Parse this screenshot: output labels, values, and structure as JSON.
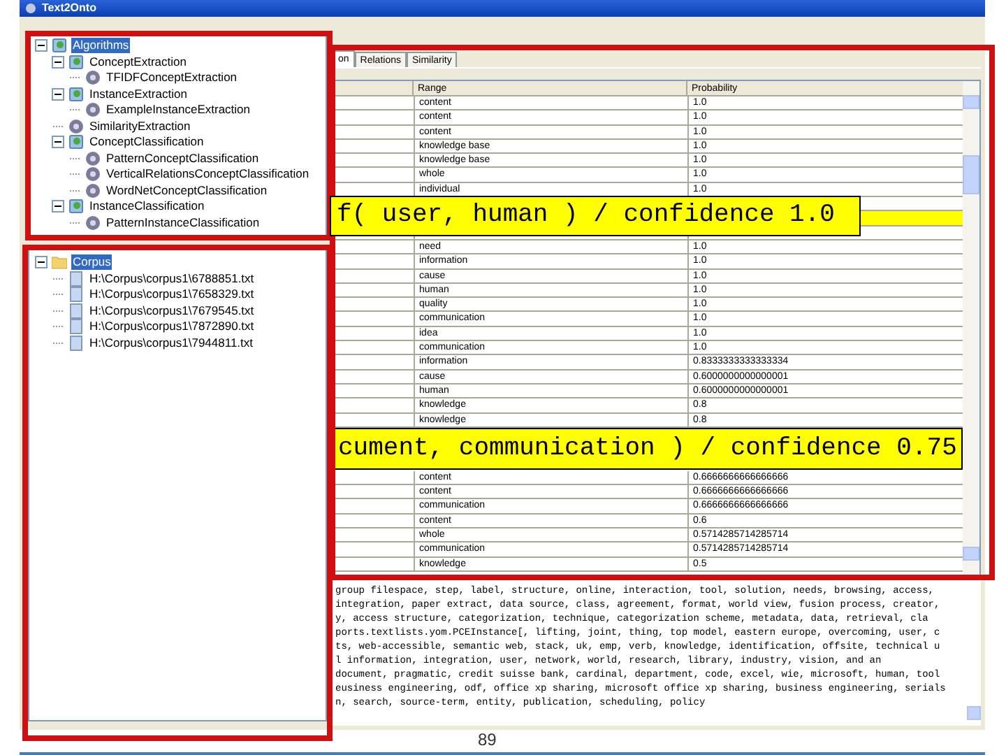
{
  "window": {
    "title": "Text2Onto"
  },
  "algorithm_tree": [
    {
      "label": "Algorithms",
      "kind": "algorithm",
      "selected": true,
      "expanded": true,
      "children": [
        {
          "label": "ConceptExtraction",
          "kind": "algorithm",
          "selected": false,
          "expanded": true,
          "children": [
            {
              "label": "TFIDFConceptExtraction",
              "kind": "method",
              "selected": false
            }
          ]
        },
        {
          "label": "InstanceExtraction",
          "kind": "algorithm",
          "selected": false,
          "expanded": true,
          "children": [
            {
              "label": "ExampleInstanceExtraction",
              "kind": "method",
              "selected": false
            }
          ]
        },
        {
          "label": "SimilarityExtraction",
          "kind": "method",
          "selected": false
        },
        {
          "label": "ConceptClassification",
          "kind": "algorithm",
          "selected": false,
          "expanded": true,
          "children": [
            {
              "label": "PatternConceptClassification",
              "kind": "method",
              "selected": false
            },
            {
              "label": "VerticalRelationsConceptClassification",
              "kind": "method",
              "selected": false
            },
            {
              "label": "WordNetConceptClassification",
              "kind": "method",
              "selected": false
            }
          ]
        },
        {
          "label": "InstanceClassification",
          "kind": "algorithm",
          "selected": false,
          "expanded": true,
          "children": [
            {
              "label": "PatternInstanceClassification",
              "kind": "method",
              "selected": false
            }
          ]
        }
      ]
    }
  ],
  "corpus_tree": [
    {
      "label": "Corpus",
      "kind": "folder",
      "selected": true,
      "expanded": true,
      "children": [
        {
          "label": "H:\\Corpus\\corpus1\\6788851.txt",
          "kind": "file",
          "selected": false
        },
        {
          "label": "H:\\Corpus\\corpus1\\7658329.txt",
          "kind": "file",
          "selected": false
        },
        {
          "label": "H:\\Corpus\\corpus1\\7679545.txt",
          "kind": "file",
          "selected": false
        },
        {
          "label": "H:\\Corpus\\corpus1\\7872890.txt",
          "kind": "file",
          "selected": false
        },
        {
          "label": "H:\\Corpus\\corpus1\\7944811.txt",
          "kind": "file",
          "selected": false
        }
      ]
    }
  ],
  "tabs": [
    {
      "label": "on",
      "selected": true
    },
    {
      "label": "Relations",
      "selected": false
    },
    {
      "label": "Similarity",
      "selected": false
    }
  ],
  "table": {
    "columns": [
      "Range",
      "Probability"
    ],
    "rows": [
      {
        "kind": "row",
        "range": "content",
        "probability": "1.0",
        "selected": false
      },
      {
        "kind": "row",
        "range": "content",
        "probability": "1.0",
        "selected": false
      },
      {
        "kind": "row",
        "range": "content",
        "probability": "1.0",
        "selected": false
      },
      {
        "kind": "row",
        "range": "knowledge base",
        "probability": "1.0",
        "selected": false
      },
      {
        "kind": "row",
        "range": "knowledge base",
        "probability": "1.0",
        "selected": false
      },
      {
        "kind": "row",
        "range": "whole",
        "probability": "1.0",
        "selected": false
      },
      {
        "kind": "row",
        "range": "individual",
        "probability": "1.0",
        "selected": false
      },
      {
        "kind": "row",
        "selected": false
      },
      {
        "kind": "row",
        "selected": true
      },
      {
        "kind": "row",
        "selected": false
      },
      {
        "kind": "row",
        "range": "need",
        "probability": "1.0",
        "selected": false
      },
      {
        "kind": "row",
        "range": "information",
        "probability": "1.0",
        "selected": false
      },
      {
        "kind": "row",
        "range": "cause",
        "probability": "1.0",
        "selected": false
      },
      {
        "kind": "row",
        "range": "human",
        "probability": "1.0",
        "selected": false
      },
      {
        "kind": "row",
        "range": "quality",
        "probability": "1.0",
        "selected": false
      },
      {
        "kind": "row",
        "range": "communication",
        "probability": "1.0",
        "selected": false
      },
      {
        "kind": "row",
        "range": "idea",
        "probability": "1.0",
        "selected": false
      },
      {
        "kind": "row",
        "range": "communication",
        "probability": "1.0",
        "selected": false
      },
      {
        "kind": "row",
        "range": "information",
        "probability": "0.8333333333333334",
        "selected": false
      },
      {
        "kind": "row",
        "range": "cause",
        "probability": "0.6000000000000001",
        "selected": false
      },
      {
        "kind": "row",
        "range": "human",
        "probability": "0.6000000000000001",
        "selected": false
      },
      {
        "kind": "row",
        "range": "knowledge",
        "probability": "0.8",
        "selected": false
      },
      {
        "kind": "row",
        "range": "knowledge",
        "probability": "0.8",
        "selected": false
      },
      {
        "kind": "callout",
        "text": "cument, communication ) / confidence 0.75"
      },
      {
        "kind": "row",
        "range": "content",
        "probability": "0.6666666666666666",
        "selected": false
      },
      {
        "kind": "row",
        "range": "content",
        "probability": "0.6666666666666666",
        "selected": false
      },
      {
        "kind": "row",
        "range": "communication",
        "probability": "0.6666666666666666",
        "selected": false
      },
      {
        "kind": "row",
        "range": "content",
        "probability": "0.6",
        "selected": false
      },
      {
        "kind": "row",
        "range": "whole",
        "probability": "0.5714285714285714",
        "selected": false
      },
      {
        "kind": "row",
        "range": "communication",
        "probability": "0.5714285714285714",
        "selected": false
      },
      {
        "kind": "row",
        "range": "knowledge",
        "probability": "0.5",
        "selected": false
      }
    ]
  },
  "text_area": [
    "group filespace, step, label, structure, online, interaction, tool, solution, needs, browsing, access,",
    "integration, paper extract, data source, class, agreement, format, world view, fusion process, creator,",
    "y, access structure, categorization, technique, categorization scheme, metadata, data, retrieval, cla",
    "ports.textlists.yom.PCEInstance[, lifting, joint, thing, top model, eastern europe, overcoming, user, c",
    "ts, web-accessible, semantic web, stack, uk, emp, verb, knowledge, identification, offsite, technical u",
    "l information, integration, user, network, world, research, library, industry, vision, and an",
    "document, pragmatic, credit suisse bank, cardinal, department, code, excel, wie, microsoft, human, tool",
    "eusiness engineering, odf, office xp sharing, microsoft office xp sharing, business engineering, serials",
    "n, search, source-term, entity, publication, scheduling, policy"
  ],
  "callout": "f( user, human ) / confidence 1.0",
  "page_number": "89"
}
